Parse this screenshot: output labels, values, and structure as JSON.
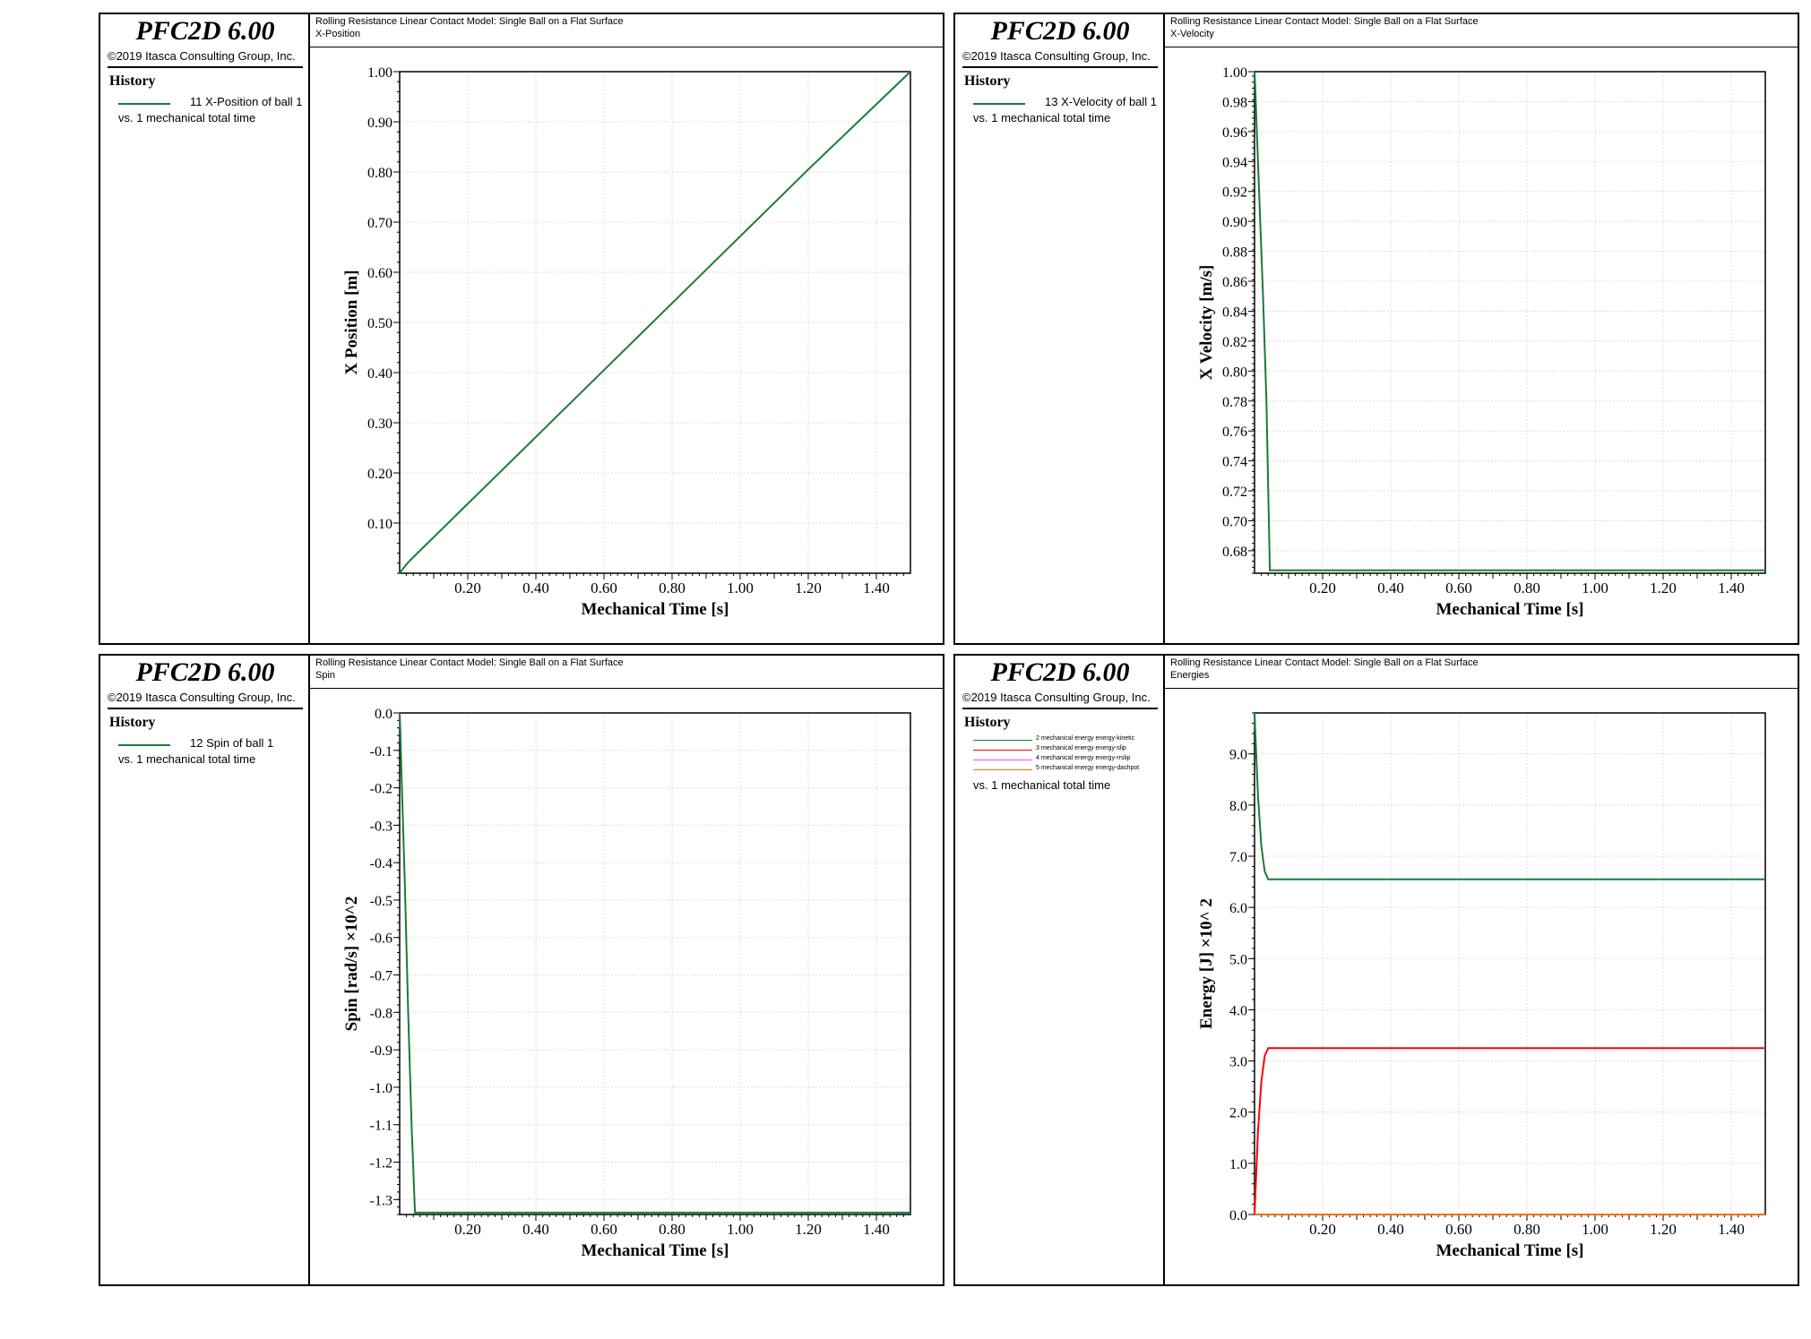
{
  "brand": "PFC2D 6.00",
  "copyright": "©2019 Itasca Consulting Group, Inc.",
  "history_heading": "History",
  "vs_label": "vs. 1 mechanical total time",
  "colors": {
    "green": "#1b7a3a",
    "red": "#ff0000",
    "magenta": "#ff44ff",
    "orange": "#ff6a00",
    "grid": "#dcdcdc"
  },
  "panels": [
    {
      "title": "Rolling Resistance Linear Contact Model: Single Ball on a Flat Surface",
      "subtitle": "X-Position",
      "legend": [
        {
          "label": "11 X-Position of ball 1",
          "color": "#1b7a3a"
        }
      ]
    },
    {
      "title": "Rolling Resistance Linear Contact Model: Single Ball on a Flat Surface",
      "subtitle": "X-Velocity",
      "legend": [
        {
          "label": "13 X-Velocity of ball 1",
          "color": "#1b7a3a"
        }
      ]
    },
    {
      "title": "Rolling Resistance Linear Contact Model: Single Ball on a Flat Surface",
      "subtitle": "Spin",
      "legend": [
        {
          "label": "12 Spin of ball 1",
          "color": "#1b7a3a"
        }
      ]
    },
    {
      "title": "Rolling Resistance Linear Contact Model: Single Ball on a Flat Surface",
      "subtitle": "Energies",
      "legend": [
        {
          "label": "2 mechanical energy energy-kinetic",
          "color": "#1b7a3a"
        },
        {
          "label": "3 mechanical energy energy-slip",
          "color": "#ff0000"
        },
        {
          "label": "4 mechanical energy energy-rrslip",
          "color": "#ff44ff"
        },
        {
          "label": "5 mechanical energy energy-dashpot",
          "color": "#ff6a00"
        }
      ]
    }
  ],
  "chart_data": [
    {
      "type": "line",
      "xlabel": "Mechanical Time [s]",
      "ylabel": "X Position [m]",
      "xlim": [
        0.0,
        1.5
      ],
      "ylim": [
        0.0,
        1.0
      ],
      "xticks": [
        "0.20",
        "0.40",
        "0.60",
        "0.80",
        "1.00",
        "1.20",
        "1.40"
      ],
      "xtick_values": [
        0.2,
        0.4,
        0.6,
        0.8,
        1.0,
        1.2,
        1.4
      ],
      "yticks": [
        "0.10",
        "0.20",
        "0.30",
        "0.40",
        "0.50",
        "0.60",
        "0.70",
        "0.80",
        "0.90",
        "1.00"
      ],
      "ytick_values": [
        0.1,
        0.2,
        0.3,
        0.4,
        0.5,
        0.6,
        0.7,
        0.8,
        0.9,
        1.0
      ],
      "grid": true,
      "series": [
        {
          "color": "#1b7a3a",
          "x": [
            0.0,
            0.02,
            0.04,
            0.3,
            0.6,
            0.9,
            1.2,
            1.5
          ],
          "y": [
            0.0,
            0.018,
            0.032,
            0.205,
            0.405,
            0.605,
            0.805,
            1.0
          ]
        }
      ]
    },
    {
      "type": "line",
      "xlabel": "Mechanical Time [s]",
      "ylabel": "X Velocity [m/s]",
      "xlim": [
        0.0,
        1.5
      ],
      "ylim": [
        0.665,
        1.0
      ],
      "xticks": [
        "0.20",
        "0.40",
        "0.60",
        "0.80",
        "1.00",
        "1.20",
        "1.40"
      ],
      "xtick_values": [
        0.2,
        0.4,
        0.6,
        0.8,
        1.0,
        1.2,
        1.4
      ],
      "yticks": [
        "0.68",
        "0.70",
        "0.72",
        "0.74",
        "0.76",
        "0.78",
        "0.80",
        "0.82",
        "0.84",
        "0.86",
        "0.88",
        "0.90",
        "0.92",
        "0.94",
        "0.96",
        "0.98",
        "1.00"
      ],
      "ytick_values": [
        0.68,
        0.7,
        0.72,
        0.74,
        0.76,
        0.78,
        0.8,
        0.82,
        0.84,
        0.86,
        0.88,
        0.9,
        0.92,
        0.94,
        0.96,
        0.98,
        1.0
      ],
      "grid": true,
      "series": [
        {
          "color": "#1b7a3a",
          "x": [
            0.0,
            0.002,
            0.006,
            0.015,
            0.025,
            0.035,
            0.045,
            1.5
          ],
          "y": [
            1.0,
            0.99,
            0.965,
            0.91,
            0.85,
            0.78,
            0.667,
            0.667
          ]
        }
      ]
    },
    {
      "type": "line",
      "xlabel": "Mechanical Time [s]",
      "ylabel": "Spin [rad/s] ×10^2",
      "xlim": [
        0.0,
        1.5
      ],
      "ylim": [
        -1.34,
        0.0
      ],
      "xticks": [
        "0.20",
        "0.40",
        "0.60",
        "0.80",
        "1.00",
        "1.20",
        "1.40"
      ],
      "xtick_values": [
        0.2,
        0.4,
        0.6,
        0.8,
        1.0,
        1.2,
        1.4
      ],
      "yticks": [
        "0.0",
        "-0.1",
        "-0.2",
        "-0.3",
        "-0.4",
        "-0.5",
        "-0.6",
        "-0.7",
        "-0.8",
        "-0.9",
        "-1.0",
        "-1.1",
        "-1.2",
        "-1.3"
      ],
      "ytick_values": [
        0.0,
        -0.1,
        -0.2,
        -0.3,
        -0.4,
        -0.5,
        -0.6,
        -0.7,
        -0.8,
        -0.9,
        -1.0,
        -1.1,
        -1.2,
        -1.3
      ],
      "grid": true,
      "series": [
        {
          "color": "#1b7a3a",
          "x": [
            0.0,
            0.002,
            0.005,
            0.015,
            0.025,
            0.035,
            0.045,
            1.5
          ],
          "y": [
            0.0,
            -0.05,
            -0.15,
            -0.45,
            -0.8,
            -1.1,
            -1.335,
            -1.335
          ]
        }
      ]
    },
    {
      "type": "line",
      "xlabel": "Mechanical Time [s]",
      "ylabel": "Energy [J] ×10^ 2",
      "xlim": [
        0.0,
        1.5
      ],
      "ylim": [
        0.0,
        9.8
      ],
      "xticks": [
        "0.20",
        "0.40",
        "0.60",
        "0.80",
        "1.00",
        "1.20",
        "1.40"
      ],
      "xtick_values": [
        0.2,
        0.4,
        0.6,
        0.8,
        1.0,
        1.2,
        1.4
      ],
      "yticks": [
        "0.0",
        "1.0",
        "2.0",
        "3.0",
        "4.0",
        "5.0",
        "6.0",
        "7.0",
        "8.0",
        "9.0"
      ],
      "ytick_values": [
        0.0,
        1.0,
        2.0,
        3.0,
        4.0,
        5.0,
        6.0,
        7.0,
        8.0,
        9.0
      ],
      "grid": true,
      "series": [
        {
          "color": "#1b7a3a",
          "x": [
            0.0,
            0.005,
            0.01,
            0.02,
            0.03,
            0.04,
            1.5
          ],
          "y": [
            9.8,
            9.0,
            8.2,
            7.2,
            6.7,
            6.55,
            6.55
          ]
        },
        {
          "color": "#ff0000",
          "x": [
            0.0,
            0.005,
            0.01,
            0.02,
            0.03,
            0.04,
            1.5
          ],
          "y": [
            0.0,
            0.8,
            1.6,
            2.6,
            3.1,
            3.25,
            3.25
          ]
        },
        {
          "color": "#ff44ff",
          "x": [
            0.0,
            1.5
          ],
          "y": [
            0.0,
            0.0
          ]
        },
        {
          "color": "#ff6a00",
          "x": [
            0.0,
            1.5
          ],
          "y": [
            0.0,
            0.0
          ]
        }
      ]
    }
  ]
}
